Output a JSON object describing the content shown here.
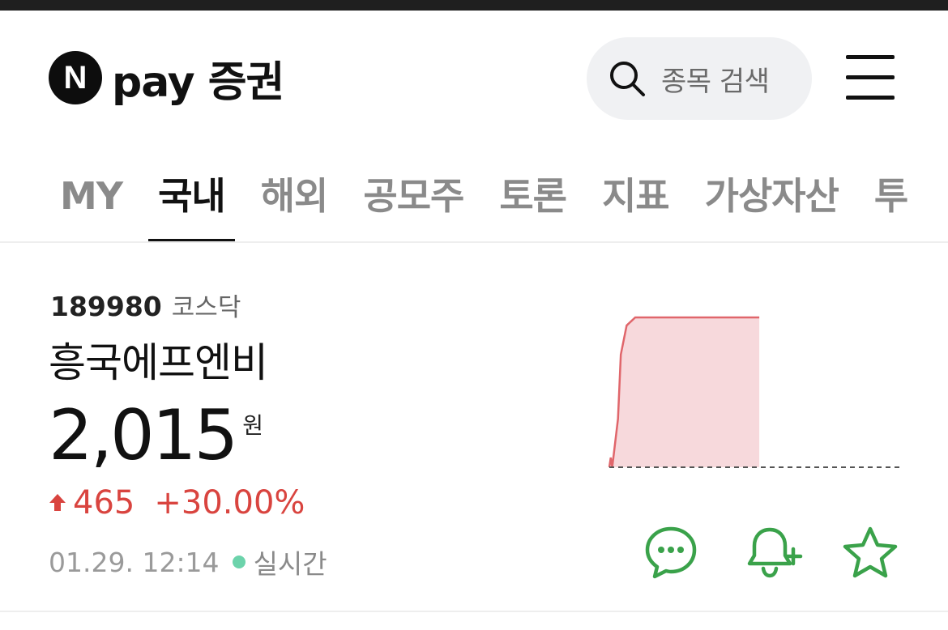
{
  "header": {
    "logo_mark": "N",
    "logo_text": "pay 증권",
    "search_placeholder": "종목 검색",
    "icons": [
      "search-icon",
      "hamburger-menu-icon"
    ]
  },
  "tabs": [
    {
      "label": "MY",
      "active": false
    },
    {
      "label": "국내",
      "active": true
    },
    {
      "label": "해외",
      "active": false
    },
    {
      "label": "공모주",
      "active": false
    },
    {
      "label": "토론",
      "active": false
    },
    {
      "label": "지표",
      "active": false
    },
    {
      "label": "가상자산",
      "active": false
    },
    {
      "label": "투",
      "active": false
    }
  ],
  "stock": {
    "code": "189980",
    "market": "코스닥",
    "name": "흥국에프엔비",
    "price": "2,015",
    "unit": "원",
    "change": "465",
    "rate": "+30.00%",
    "time": "01.29. 12:14",
    "live_label": "실시간"
  },
  "colors": {
    "up": "#d9443f",
    "chart_fill": "#f7d9dc",
    "chart_line": "#e0666b",
    "live_dot": "#6cd3ab",
    "action_icon": "#3aa24a"
  },
  "chart_data": {
    "type": "area",
    "x": [
      0,
      0.5,
      1,
      3,
      4,
      6,
      9,
      12,
      15,
      18,
      22,
      28,
      34,
      40,
      46,
      52
    ],
    "values": [
      1550,
      1580,
      1550,
      1700,
      1900,
      1990,
      2015,
      2015,
      2015,
      2015,
      2015,
      2015,
      2015,
      2015,
      2015,
      2015
    ],
    "baseline": 1550,
    "x_range": [
      0,
      100
    ],
    "y_range": [
      1550,
      2015
    ]
  },
  "actions": [
    {
      "icon": "chat-bubble-icon"
    },
    {
      "icon": "bell-add-icon"
    },
    {
      "icon": "star-icon"
    }
  ]
}
